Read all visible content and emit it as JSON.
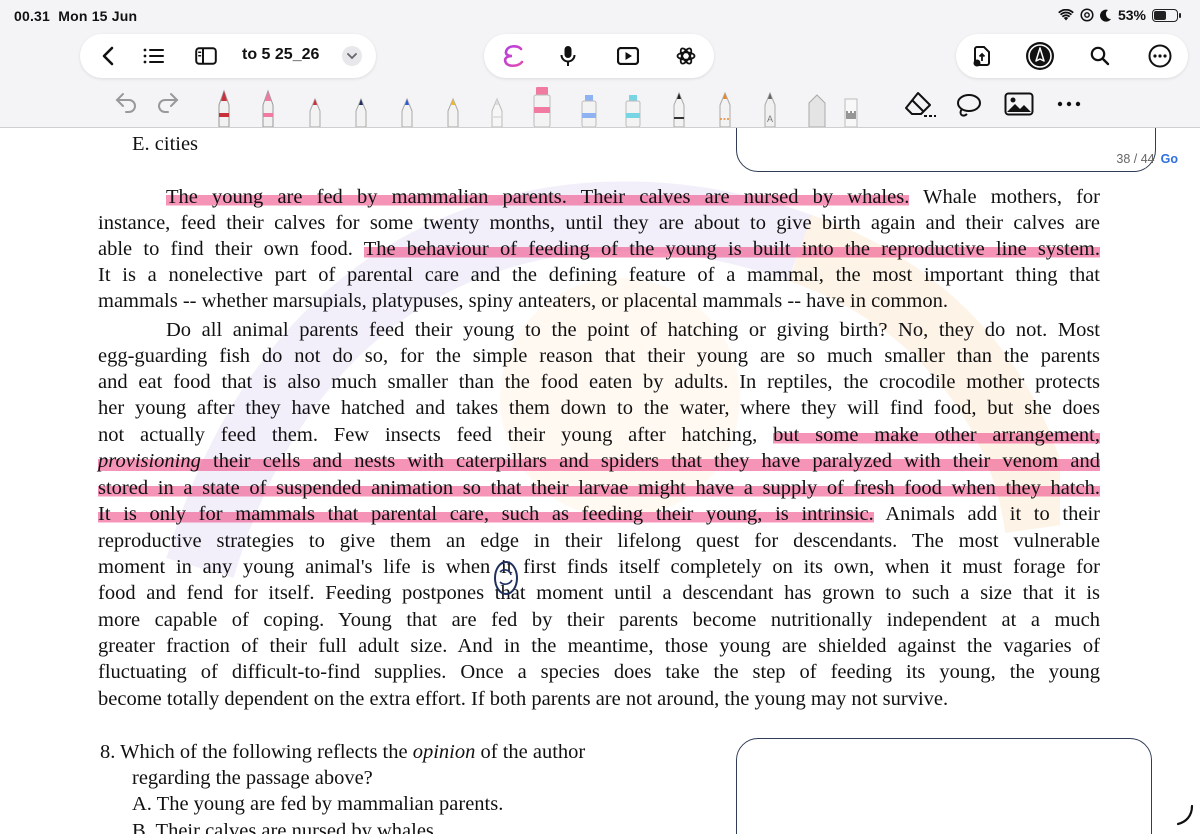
{
  "status_bar": {
    "time": "00.31",
    "date": "Mon 15 Jun",
    "battery": "53%"
  },
  "toolbar": {
    "doc_title": "to 5 25_26",
    "icons": [
      "back-chevron-icon",
      "list-icon",
      "sidebar-icon",
      "chevron-down-icon",
      "assistant-icon",
      "microphone-icon",
      "play-icon",
      "openai-icon",
      "share-doc-icon",
      "pen-circle-icon",
      "search-icon",
      "more-icon"
    ]
  },
  "tools": {
    "icons": [
      "undo-icon",
      "redo-icon",
      "fountain-pen-red",
      "fountain-pen-pink",
      "ballpoint-red",
      "ballpoint-navy",
      "ballpoint-blue",
      "ballpoint-yellow",
      "pencil-grey",
      "highlighter-pink",
      "highlighter-blue",
      "highlighter-cyan",
      "pencil-black",
      "pencil-orange",
      "pencil-grey-a",
      "shape-tool",
      "ruler-icon",
      "eraser-icon",
      "lasso-icon",
      "image-icon",
      "more-tools-icon"
    ],
    "colors": {
      "red": "#c8303a",
      "pink": "#f07aa0",
      "navy": "#1f2f5e",
      "blue": "#2d5bd1",
      "yellow": "#f2b92b",
      "highlight": "#f0528c",
      "cyan": "#78d6e4",
      "orange": "#e58a2b"
    }
  },
  "page_indicator": {
    "text": "38 / 44",
    "go": "Go"
  },
  "document": {
    "option_e": "E.  cities",
    "p1": {
      "l1_hl": "The young are fed by mammalian parents. Their calves are nursed by whales.",
      "l1_rest": " Whale mothers, for",
      "l2": "instance, feed their calves for some twenty months, until they are about to give birth again and their calves are",
      "l3_a": "able to find their own food. ",
      "l3_hl": "The behaviour of feeding of the young is built into the reproductive line system.",
      "l4": "It is a nonelective part of parental care and the defining feature of a mammal, the most important thing that",
      "l5": "mammals -- whether marsupials, platypuses, spiny anteaters, or placental mammals -- have in common."
    },
    "p2": {
      "l1": "Do all animal parents feed their young to the point of hatching or giving birth? No, they do not.  Most",
      "l2": "egg-guarding fish do not do so, for the simple reason that their young are so much smaller than the parents",
      "l3": "and eat food that is also much smaller than the food eaten by adults. In reptiles, the crocodile mother protects",
      "l4": "her young after they have hatched and takes them down to the water, where they will find food, but she does",
      "l5_a": "not actually feed them. Few insects feed their young after hatching, ",
      "l5_hl": "but some make other arrangement,",
      "l6_it": "provisioning",
      "l6_hl": " their cells and nests with caterpillars and spiders that they have paralyzed with their venom and",
      "l7_hl": "stored in a state of suspended animation so that their larvae might have a supply of fresh food when they hatch.",
      "l8_hl": "It is only for mammals that parental care, such as feeding their young, is intrinsic.",
      "l8_rest": " Animals add it to their",
      "l9": "reproductive strategies to give them an edge in their lifelong quest for descendants. The most vulnerable",
      "l10": "moment in any young animal's life is when it first finds itself completely on its own, when it must forage for",
      "l11": "food and fend for itself. Feeding postpones that moment until a descendant has grown to such a size that it is",
      "l12": "more capable of coping. Young that are fed by their parents become nutritionally independent at a much",
      "l13": "greater fraction of their full adult size. And in the meantime, those young are shielded against the vagaries of",
      "l14": "fluctuating of difficult-to-find supplies. Once a species does take the step of feeding its young, the young",
      "l15": "become totally dependent on the extra effort. If both parents are not around, the young may not survive."
    },
    "q8": {
      "l1_a": "8.  Which of the following reflects the ",
      "l1_it": "opinion",
      "l1_b": " of the author",
      "l2": "regarding the passage above?",
      "a": "A.  The young are fed by mammalian parents.",
      "b": "B.  Their calves are nursed by whales."
    }
  }
}
